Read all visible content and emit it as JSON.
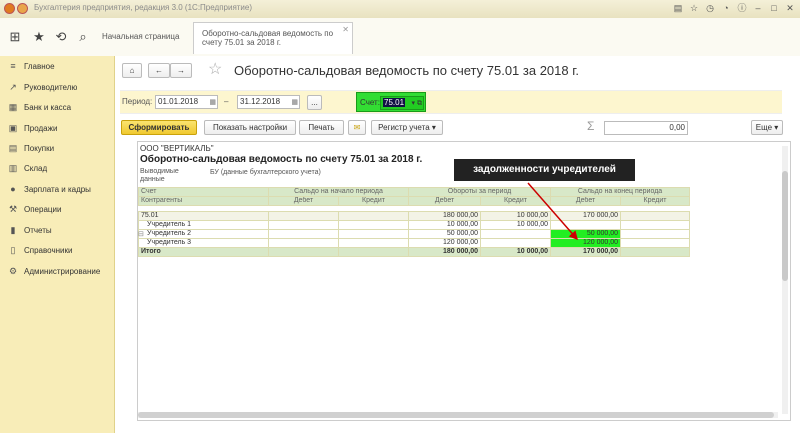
{
  "window": {
    "title": "Бухгалтерия предприятия, редакция 3.0  (1С:Предприятие)"
  },
  "tabs": [
    {
      "label": "Начальная страница"
    },
    {
      "label_line1": "Оборотно-сальдовая ведомость по",
      "label_line2": "счету 75.01 за 2018 г."
    }
  ],
  "sidebar": {
    "items": [
      {
        "label": "Главное",
        "icon": "list-icon"
      },
      {
        "label": "Руководителю",
        "icon": "chart-icon"
      },
      {
        "label": "Банк и касса",
        "icon": "bank-icon"
      },
      {
        "label": "Продажи",
        "icon": "cart-icon"
      },
      {
        "label": "Покупки",
        "icon": "basket-icon"
      },
      {
        "label": "Склад",
        "icon": "warehouse-icon"
      },
      {
        "label": "Зарплата и кадры",
        "icon": "person-icon"
      },
      {
        "label": "Операции",
        "icon": "operations-icon"
      },
      {
        "label": "Отчеты",
        "icon": "report-icon"
      },
      {
        "label": "Справочники",
        "icon": "book-icon"
      },
      {
        "label": "Администрирование",
        "icon": "gear-icon"
      }
    ]
  },
  "page": {
    "title": "Оборотно-сальдовая ведомость по счету 75.01 за 2018 г."
  },
  "filters": {
    "period_label": "Период:",
    "date_from": "01.01.2018",
    "dash": "–",
    "date_to": "31.12.2018",
    "dots": "...",
    "account_label": "Счет:",
    "account_value": "75.01"
  },
  "toolbar": {
    "generate": "Сформировать",
    "show_settings": "Показать настройки",
    "print": "Печать",
    "register": "Регистр учета",
    "sum_symbol": "Σ",
    "sum_value": "0,00",
    "more": "Еще"
  },
  "report": {
    "org": "ООО \"ВЕРТИКАЛЬ\"",
    "title": "Оборотно-сальдовая ведомость по счету 75.01 за 2018 г.",
    "output_label": "Выводимые данные",
    "output_value": "БУ (данные бухгалтерского учета)",
    "headers": {
      "account": "Счет",
      "counterparties": "Контрагенты",
      "opening": "Сальдо на начало периода",
      "turnover": "Обороты за период",
      "closing": "Сальдо на конец периода",
      "debit": "Дебет",
      "credit": "Кредит"
    },
    "rows": [
      {
        "name": "75.01",
        "turnover_debit": "180 000,00",
        "turnover_credit": "10 000,00",
        "closing_debit": "170 000,00"
      },
      {
        "name": "Учредитель 1",
        "turnover_debit": "10 000,00",
        "turnover_credit": "10 000,00",
        "closing_debit": ""
      },
      {
        "name": "Учредитель 2",
        "turnover_debit": "50 000,00",
        "turnover_credit": "",
        "closing_debit": "50 000,00"
      },
      {
        "name": "Учредитель 3",
        "turnover_debit": "120 000,00",
        "turnover_credit": "",
        "closing_debit": "120 000,00"
      }
    ],
    "total": {
      "label": "Итого",
      "turnover_debit": "180 000,00",
      "turnover_credit": "10 000,00",
      "closing_debit": "170 000,00"
    },
    "callout": "задолженности учредителей"
  }
}
